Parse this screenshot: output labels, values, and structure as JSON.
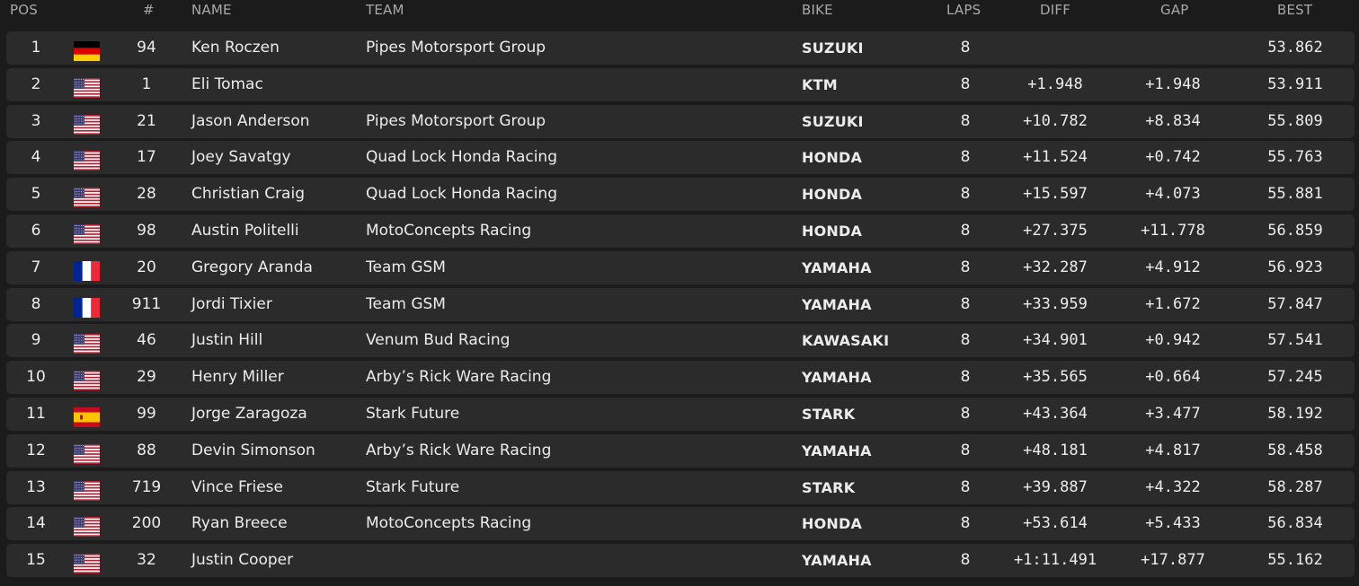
{
  "columns": {
    "pos": "POS",
    "num": "#",
    "name": "NAME",
    "team": "TEAM",
    "bike": "BIKE",
    "laps": "LAPS",
    "diff": "DIFF",
    "gap": "GAP",
    "best": "BEST"
  },
  "rows": [
    {
      "pos": "1",
      "flag": "flag-germany-icon",
      "num": "94",
      "name": "Ken Roczen",
      "team": "Pipes Motorsport Group",
      "bike": "SUZUKI",
      "laps": "8",
      "diff": "",
      "gap": "",
      "best": "53.862"
    },
    {
      "pos": "2",
      "flag": "flag-usa-icon",
      "num": "1",
      "name": "Eli Tomac",
      "team": "",
      "bike": "KTM",
      "laps": "8",
      "diff": "+1.948",
      "gap": "+1.948",
      "best": "53.911"
    },
    {
      "pos": "3",
      "flag": "flag-usa-icon",
      "num": "21",
      "name": "Jason Anderson",
      "team": "Pipes Motorsport Group",
      "bike": "SUZUKI",
      "laps": "8",
      "diff": "+10.782",
      "gap": "+8.834",
      "best": "55.809"
    },
    {
      "pos": "4",
      "flag": "flag-usa-icon",
      "num": "17",
      "name": "Joey Savatgy",
      "team": "Quad Lock Honda Racing",
      "bike": "HONDA",
      "laps": "8",
      "diff": "+11.524",
      "gap": "+0.742",
      "best": "55.763"
    },
    {
      "pos": "5",
      "flag": "flag-usa-icon",
      "num": "28",
      "name": "Christian Craig",
      "team": "Quad Lock Honda Racing",
      "bike": "HONDA",
      "laps": "8",
      "diff": "+15.597",
      "gap": "+4.073",
      "best": "55.881"
    },
    {
      "pos": "6",
      "flag": "flag-usa-icon",
      "num": "98",
      "name": "Austin Politelli",
      "team": "MotoConcepts Racing",
      "bike": "HONDA",
      "laps": "8",
      "diff": "+27.375",
      "gap": "+11.778",
      "best": "56.859"
    },
    {
      "pos": "7",
      "flag": "flag-france-icon",
      "num": "20",
      "name": "Gregory Aranda",
      "team": "Team GSM",
      "bike": "YAMAHA",
      "laps": "8",
      "diff": "+32.287",
      "gap": "+4.912",
      "best": "56.923"
    },
    {
      "pos": "8",
      "flag": "flag-france-icon",
      "num": "911",
      "name": "Jordi Tixier",
      "team": "Team GSM",
      "bike": "YAMAHA",
      "laps": "8",
      "diff": "+33.959",
      "gap": "+1.672",
      "best": "57.847"
    },
    {
      "pos": "9",
      "flag": "flag-usa-icon",
      "num": "46",
      "name": "Justin Hill",
      "team": "Venum Bud Racing",
      "bike": "KAWASAKI",
      "laps": "8",
      "diff": "+34.901",
      "gap": "+0.942",
      "best": "57.541"
    },
    {
      "pos": "10",
      "flag": "flag-usa-icon",
      "num": "29",
      "name": "Henry Miller",
      "team": "Arby’s Rick Ware Racing",
      "bike": "YAMAHA",
      "laps": "8",
      "diff": "+35.565",
      "gap": "+0.664",
      "best": "57.245"
    },
    {
      "pos": "11",
      "flag": "flag-spain-icon",
      "num": "99",
      "name": "Jorge Zaragoza",
      "team": "Stark Future",
      "bike": "STARK",
      "laps": "8",
      "diff": "+43.364",
      "gap": "+3.477",
      "best": "58.192"
    },
    {
      "pos": "12",
      "flag": "flag-usa-icon",
      "num": "88",
      "name": "Devin Simonson",
      "team": "Arby’s Rick Ware Racing",
      "bike": "YAMAHA",
      "laps": "8",
      "diff": "+48.181",
      "gap": "+4.817",
      "best": "58.458"
    },
    {
      "pos": "13",
      "flag": "flag-usa-icon",
      "num": "719",
      "name": "Vince Friese",
      "team": "Stark Future",
      "bike": "STARK",
      "laps": "8",
      "diff": "+39.887",
      "gap": "+4.322",
      "best": "58.287"
    },
    {
      "pos": "14",
      "flag": "flag-usa-icon",
      "num": "200",
      "name": "Ryan Breece",
      "team": "MotoConcepts Racing",
      "bike": "HONDA",
      "laps": "8",
      "diff": "+53.614",
      "gap": "+5.433",
      "best": "56.834"
    },
    {
      "pos": "15",
      "flag": "flag-usa-icon",
      "num": "32",
      "name": "Justin Cooper",
      "team": "",
      "bike": "YAMAHA",
      "laps": "8",
      "diff": "+1:11.491",
      "gap": "+17.877",
      "best": "55.162"
    }
  ],
  "colors": {
    "background": "#1b1b1b",
    "row_background": "#2b2b2b",
    "header_text": "#a9a9a9",
    "text": "#ececec"
  }
}
